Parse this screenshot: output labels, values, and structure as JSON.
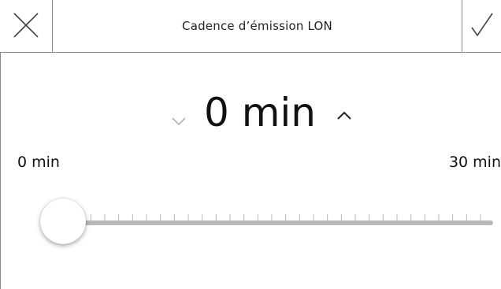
{
  "header": {
    "title": "Cadence d’émission LON",
    "cancel_icon": "close-icon",
    "confirm_icon": "checkmark-icon"
  },
  "setting": {
    "value": 0,
    "unit": "min",
    "display": "0 min",
    "decrement_icon": "chevron-down-icon",
    "increment_icon": "chevron-up-icon"
  },
  "range": {
    "min": 0,
    "max": 30,
    "min_label": "0 min",
    "max_label": "30 min",
    "step": 1
  },
  "colors": {
    "track": "#b9b9b9",
    "tick": "#b9b9b9",
    "text": "#111111",
    "border": "#8a8a8a",
    "disabled_chevron": "#b0b0b0"
  }
}
